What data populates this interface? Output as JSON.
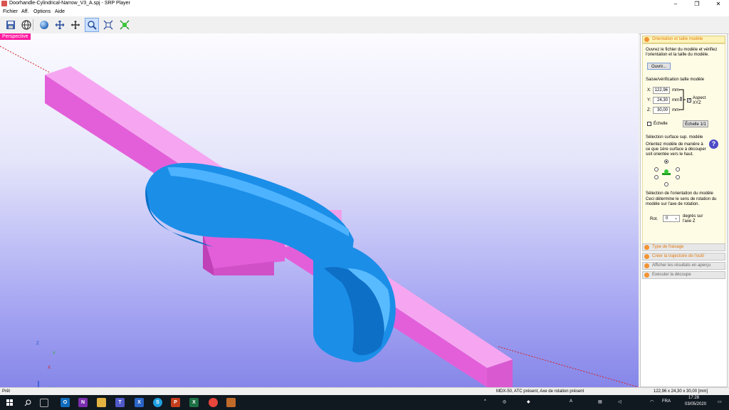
{
  "window": {
    "title": "Doorhandle-Cylindrical-Narrow_V3_A.spj - SRP Player"
  },
  "menu": [
    "Fichier",
    "Aff.",
    "Options",
    "Aide"
  ],
  "toolbar": {
    "buttons": [
      "save-icon",
      "globe-icon",
      "sphere-icon",
      "rotate-icon",
      "move-icon",
      "zoom-icon",
      "fit-icon",
      "fit-all-icon"
    ],
    "selected": "zoom-icon"
  },
  "viewport": {
    "label": "Perspective",
    "axes": {
      "x": "X",
      "y": "Y",
      "z": "Z"
    }
  },
  "panel": {
    "section1": {
      "title": "Orientation et taille modèle",
      "intro": [
        "Ouvrez le fichier du modèle et vérifiez",
        "l'orientation et la taille du modèle."
      ],
      "open_button": "Ouvrir...",
      "size_heading": "Saisie/vérification taille modèle",
      "x_label": "X:",
      "x_value": "122,96",
      "y_label": "Y:",
      "y_value": "24,30",
      "z_label": "Z:",
      "z_value": "30,00",
      "unit": "mm",
      "aspect_label": [
        "Aspect",
        "XYZ"
      ],
      "scale_label": "Échelle",
      "scale_button": "Échelle 1/1",
      "surface_heading": "Sélection surface sup. modèle",
      "surface_text": [
        "Orientez modèle de manière à",
        "ce que 1ère surface à découper",
        "soit orientée vers le haut."
      ],
      "rotation_heading": "Sélection de l'orientation du modèle",
      "rotation_text": [
        "Ceci détermine le sens de rotation du",
        "modèle sur l'axe de rotation."
      ],
      "rot_label": "Rot.",
      "rot_value": "0",
      "rot_unit": [
        "degrés sur",
        "l'axe Z"
      ]
    },
    "sections": [
      "Type de fraisage",
      "Créer la trajectoire de l'outil",
      "Afficher les résultats en aperçu",
      "Exécuter la découpe"
    ]
  },
  "status": {
    "left": "Prêt",
    "center": "MDX-50, ATC présent, Axe de rotation présent",
    "right": "122,96 x 24,30 x 30,00 [mm]"
  },
  "taskbar": {
    "lang": "FRA",
    "time": "17:28",
    "date": "03/05/2020"
  }
}
